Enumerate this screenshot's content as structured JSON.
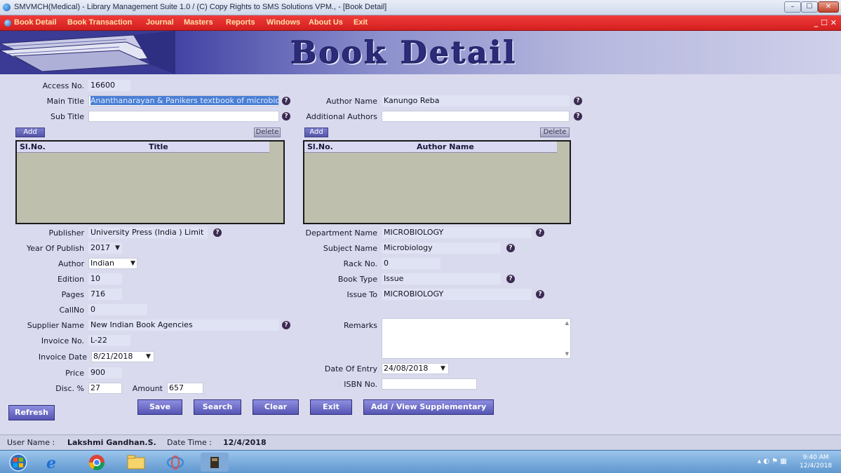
{
  "window": {
    "title": "SMVMCH(Medical) - Library Management Suite 1.0  / (C) Copy Rights to SMS Solutions VPM., - [Book Detail]",
    "min_label": "–",
    "max_label": "☐",
    "close_label": "✕"
  },
  "menu": {
    "items": [
      "Book Detail",
      "Book Transaction",
      "Journal",
      "Masters",
      "Reports",
      "Windows",
      "About Us",
      "Exit"
    ],
    "mdi_controls": "_ ☐ ✕"
  },
  "banner": {
    "title": "Book Detail"
  },
  "form": {
    "access_no": {
      "label": "Access No.",
      "value": "16600"
    },
    "main_title": {
      "label": "Main Title",
      "value": "Ananthanarayan & Panikers textbook of microbiology"
    },
    "sub_title": {
      "label": "Sub Title",
      "value": ""
    },
    "author_name": {
      "label": "Author Name",
      "value": "Kanungo Reba"
    },
    "additional_authors": {
      "label": "Additional Authors",
      "value": ""
    },
    "title_grid": {
      "add": "Add",
      "delete": "Delete",
      "col_sl": "Sl.No.",
      "col_title": "Title"
    },
    "author_grid": {
      "add": "Add",
      "delete": "Delete",
      "col_sl": "Sl.No.",
      "col_author": "Author Name"
    },
    "publisher": {
      "label": "Publisher",
      "value": "University Press (India ) Limit"
    },
    "year_of_publish": {
      "label": "Year Of Publish",
      "value": "2017"
    },
    "author": {
      "label": "Author",
      "value": "Indian"
    },
    "edition": {
      "label": "Edition",
      "value": "10"
    },
    "pages": {
      "label": "Pages",
      "value": "716"
    },
    "call_no": {
      "label": "CallNo",
      "value": "0"
    },
    "supplier_name": {
      "label": "Supplier Name",
      "value": "New Indian Book Agencies"
    },
    "invoice_no": {
      "label": "Invoice No.",
      "value": "L-22"
    },
    "invoice_date": {
      "label": "Invoice Date",
      "value": "8/21/2018"
    },
    "price": {
      "label": "Price",
      "value": "900"
    },
    "disc": {
      "label": "Disc. %",
      "value": "27"
    },
    "amount": {
      "label": "Amount",
      "value": "657"
    },
    "department_name": {
      "label": "Department Name",
      "value": "MICROBIOLOGY"
    },
    "subject_name": {
      "label": "Subject Name",
      "value": "Microbiology"
    },
    "rack_no": {
      "label": "Rack No.",
      "value": "0"
    },
    "book_type": {
      "label": "Book Type",
      "value": "Issue"
    },
    "issue_to": {
      "label": "Issue To",
      "value": "MICROBIOLOGY"
    },
    "remarks": {
      "label": "Remarks",
      "value": ""
    },
    "date_of_entry": {
      "label": "Date Of Entry",
      "value": "24/08/2018"
    },
    "isbn_no": {
      "label": "ISBN No.",
      "value": ""
    }
  },
  "buttons": {
    "refresh": "Refresh",
    "save": "Save",
    "search": "Search",
    "clear": "Clear",
    "exit": "Exit",
    "supplementary": "Add / View Supplementary"
  },
  "status": {
    "user_label": "User Name :",
    "user_value": "Lakshmi Gandhan.S.",
    "date_label": "Date Time :",
    "date_value": "12/4/2018"
  },
  "tray": {
    "time": "9:40 AM",
    "date": "12/4/2018"
  },
  "colors": {
    "menu_bar": "#e02a2a",
    "menu_text": "#ffe0a8",
    "banner_title": "#2b2b7a",
    "form_bg": "#d9daed",
    "grid_bg": "#bfbfae"
  }
}
